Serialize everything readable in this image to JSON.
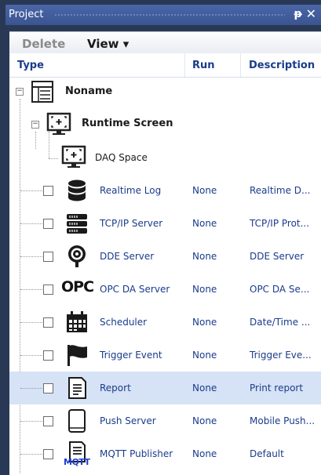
{
  "window": {
    "title": "Project",
    "pin_glyph": "ᵖ",
    "close_glyph": "✕"
  },
  "toolbar": {
    "delete_label": "Delete",
    "view_label": "View ▾"
  },
  "columns": {
    "type": "Type",
    "run": "Run",
    "description": "Description"
  },
  "tree": {
    "root": {
      "name": "Noname",
      "icon": "document-list-icon"
    },
    "screen": {
      "name": "Runtime Screen",
      "icon": "monitor-icon"
    },
    "daq": {
      "name": "DAQ Space",
      "icon": "monitor-icon"
    }
  },
  "items": [
    {
      "name": "Realtime Log",
      "run": "None",
      "description": "Realtime D...",
      "icon": "database-icon"
    },
    {
      "name": "TCP/IP Server",
      "run": "None",
      "description": "TCP/IP Prot...",
      "icon": "server-rack-icon"
    },
    {
      "name": "DDE Server",
      "run": "None",
      "description": "DDE Server",
      "icon": "dde-icon"
    },
    {
      "name": "OPC DA Server",
      "run": "None",
      "description": "OPC DA Se...",
      "icon": "opc-icon",
      "logo_text": "OPC"
    },
    {
      "name": "Scheduler",
      "run": "None",
      "description": "Date/Time ...",
      "icon": "calendar-icon"
    },
    {
      "name": "Trigger Event",
      "run": "None",
      "description": "Trigger Eve...",
      "icon": "flag-icon"
    },
    {
      "name": "Report",
      "run": "None",
      "description": "Print report",
      "icon": "report-icon"
    },
    {
      "name": "Push Server",
      "run": "None",
      "description": "Mobile Push...",
      "icon": "tablet-icon"
    },
    {
      "name": "MQTT Publisher",
      "run": "None",
      "description": "Default",
      "icon": "mqtt-icon",
      "logo_text": "MQTT"
    }
  ],
  "colors": {
    "title_bar": "#3a5590",
    "link_text": "#1a3c8a",
    "selected_row": "#d6e2f5"
  }
}
